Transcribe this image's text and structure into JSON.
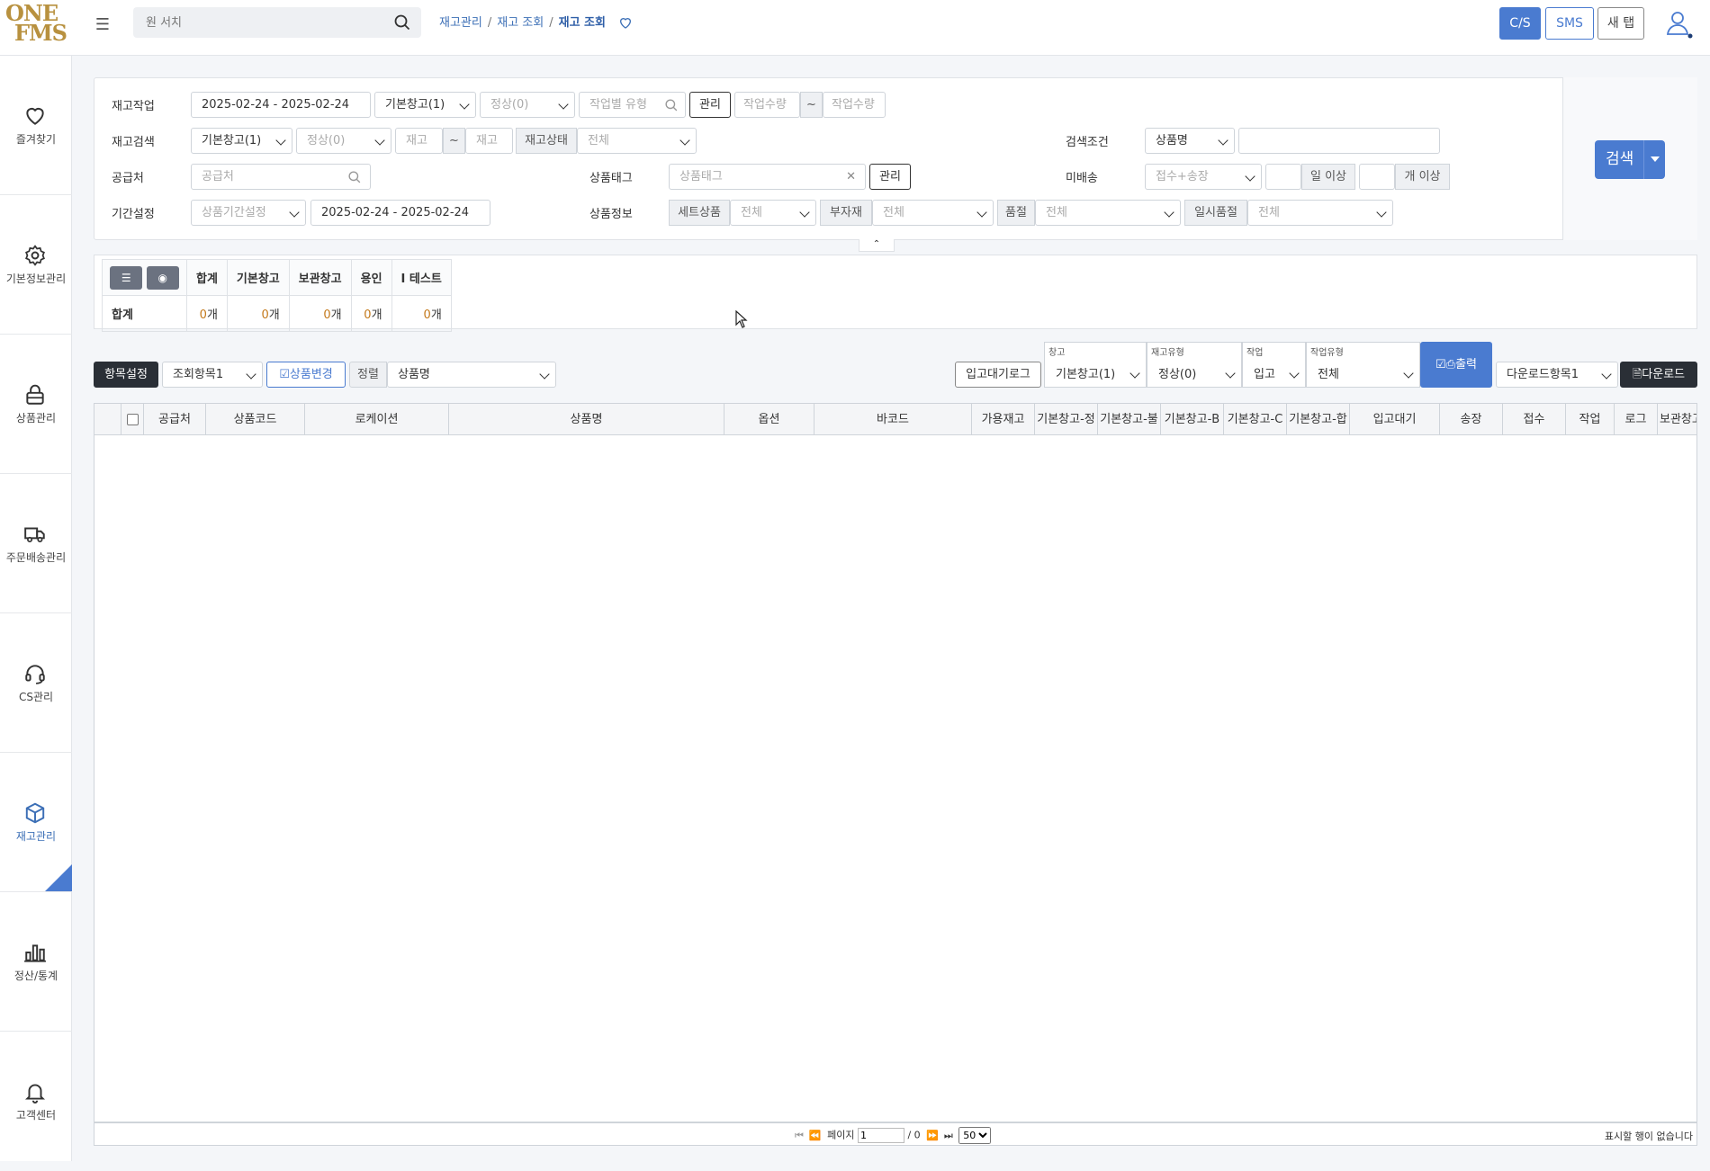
{
  "app": {
    "logo_top": "ONE",
    "logo_bottom": "FMS"
  },
  "header": {
    "search_placeholder": "원 서치",
    "breadcrumb": [
      "재고관리",
      "재고 조회",
      "재고 조회"
    ],
    "buttons": {
      "cs": "C/S",
      "sms": "SMS",
      "newtab": "새 탭"
    }
  },
  "sidebar": {
    "items": [
      {
        "label": "즐겨찾기",
        "icon": "heart-icon"
      },
      {
        "label": "기본정보관리",
        "icon": "gear-icon"
      },
      {
        "label": "상품관리",
        "icon": "lock-icon"
      },
      {
        "label": "주문배송관리",
        "icon": "truck-icon"
      },
      {
        "label": "CS관리",
        "icon": "headset-icon"
      },
      {
        "label": "재고관리",
        "icon": "box-icon",
        "active": true
      },
      {
        "label": "정산/통계",
        "icon": "bar-chart-icon"
      },
      {
        "label": "고객센터",
        "icon": "bell-icon"
      }
    ]
  },
  "filters": {
    "row1": {
      "label": "재고작업",
      "date": "2025-02-24 - 2025-02-24",
      "warehouse": "기본창고(1)",
      "status": "정상(0)",
      "worktype_placeholder": "작업별 유형",
      "manage": "관리",
      "qty_from": "작업수량",
      "tilde": "~",
      "qty_to": "작업수량"
    },
    "row2": {
      "label": "재고검색",
      "warehouse": "기본창고(1)",
      "status": "정상(0)",
      "stock_from": "재고",
      "tilde": "~",
      "stock_to": "재고",
      "state_label": "재고상태",
      "state_value": "전체",
      "cond_label": "검색조건",
      "cond_value": "상품명",
      "cond_input": ""
    },
    "row3": {
      "label": "공급처",
      "supplier_placeholder": "공급처",
      "tag_label": "상품태그",
      "tag_placeholder": "상품태그",
      "manage": "관리",
      "undelivered_label": "미배송",
      "undelivered_value": "접수+송장",
      "days_suffix": "일 이상",
      "count_suffix": "개 이상"
    },
    "row4": {
      "label": "기간설정",
      "period_placeholder": "상품기간설정",
      "date": "2025-02-24 - 2025-02-24",
      "info_label": "상품정보",
      "set_label": "세트상품",
      "set_value": "전체",
      "sub_label": "부자재",
      "sub_value": "전체",
      "soldout_label": "품절",
      "soldout_value": "전체",
      "temp_label": "일시품절",
      "temp_value": "전체"
    },
    "search_button": "검색"
  },
  "summary": {
    "headers": [
      "합계",
      "기본창고",
      "보관창고",
      "용인",
      "I 테스트"
    ],
    "row_label": "합계",
    "values": [
      "0",
      "0",
      "0",
      "0",
      "0"
    ],
    "unit": "개"
  },
  "toolbar": {
    "item_settings": "항목설정",
    "view_items": "조회항목1",
    "change_product": "상품변경",
    "sort_label": "정렬",
    "sort_value": "상품명",
    "inbound_log": "입고대기로그",
    "warehouse_cap": "창고",
    "warehouse_val": "기본창고(1)",
    "stocktype_cap": "재고유형",
    "stocktype_val": "정상(0)",
    "work_cap": "작업",
    "work_val": "입고",
    "worktype_cap": "작업유형",
    "worktype_val": "전체",
    "print": "출력",
    "download_items": "다운로드항목1",
    "download": "다운로드"
  },
  "grid": {
    "columns": [
      "공급처",
      "상품코드",
      "로케이션",
      "상품명",
      "옵션",
      "바코드",
      "가용재고",
      "기본창고-정",
      "기본창고-불",
      "기본창고-B",
      "기본창고-C",
      "기본창고-합",
      "입고대기",
      "송장",
      "접수",
      "작업",
      "로그",
      "보관창고"
    ]
  },
  "pager": {
    "page_label": "페이지",
    "page_value": "1",
    "total": "/ 0",
    "page_size": "50",
    "empty_message": "표시할 행이 없습니다"
  }
}
